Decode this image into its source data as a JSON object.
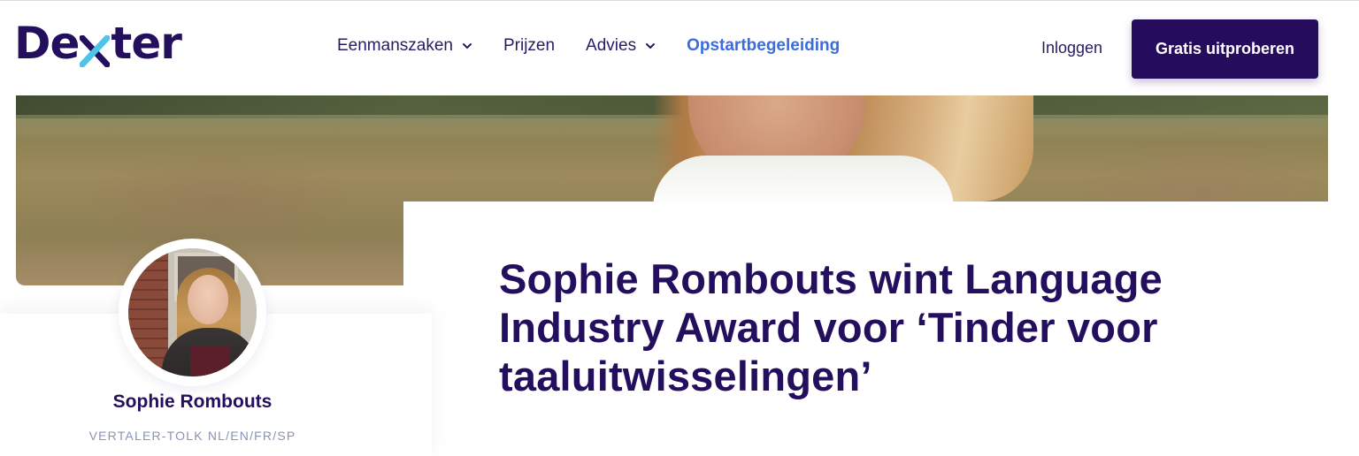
{
  "brand": {
    "logo_text_left": "De",
    "logo_text_right": "ter",
    "colors": {
      "navy": "#240f5e",
      "accent_blue": "#3b6be0",
      "cyan": "#4fc3e8"
    }
  },
  "nav": {
    "items": [
      {
        "label": "Eenmanszaken",
        "has_dropdown": true,
        "active": false
      },
      {
        "label": "Prijzen",
        "has_dropdown": false,
        "active": false
      },
      {
        "label": "Advies",
        "has_dropdown": true,
        "active": false
      },
      {
        "label": "Opstartbegeleiding",
        "has_dropdown": false,
        "active": true
      }
    ],
    "login_label": "Inloggen",
    "cta_label": "Gratis uitproberen"
  },
  "article": {
    "title": "Sophie Rombouts wint Language Industry Award voor ‘Tinder voor taaluitwisselingen’"
  },
  "author": {
    "name": "Sophie Rombouts",
    "role": "VERTALER-TOLK NL/EN/FR/SP"
  }
}
